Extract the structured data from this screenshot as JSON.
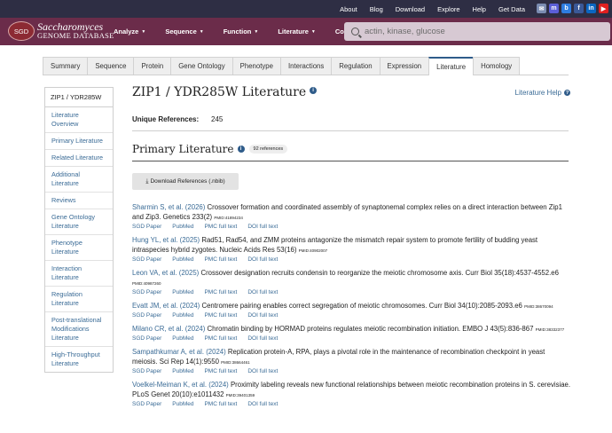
{
  "topbar": {
    "links": [
      "About",
      "Blog",
      "Download",
      "Explore",
      "Help",
      "Get Data"
    ],
    "social_icons": [
      {
        "name": "email-icon",
        "glyph": "✉",
        "color": "#7b8cb1"
      },
      {
        "name": "mastodon-icon",
        "glyph": "m",
        "color": "#5b5fd8"
      },
      {
        "name": "bluesky-icon",
        "glyph": "b",
        "color": "#2e7de0"
      },
      {
        "name": "facebook-icon",
        "glyph": "f",
        "color": "#3b5998"
      },
      {
        "name": "linkedin-icon",
        "glyph": "in",
        "color": "#0a66c2"
      },
      {
        "name": "youtube-icon",
        "glyph": "▶",
        "color": "#e02020"
      }
    ]
  },
  "navbar": {
    "logo_badge": "SGD",
    "logo_line1": "Saccharomyces",
    "logo_line2": "GENOME DATABASE",
    "menu": [
      "Analyze",
      "Sequence",
      "Function",
      "Literature",
      "Community"
    ],
    "search_placeholder": "actin, kinase, glucose"
  },
  "tabs": [
    "Summary",
    "Sequence",
    "Protein",
    "Gene Ontology",
    "Phenotype",
    "Interactions",
    "Regulation",
    "Expression",
    "Literature",
    "Homology"
  ],
  "active_tab": "Literature",
  "sidebar": {
    "header": "ZIP1 / YDR285W",
    "items": [
      "Literature Overview",
      "Primary Literature",
      "Related Literature",
      "Additional Literature",
      "Reviews",
      "Gene Ontology Literature",
      "Phenotype Literature",
      "Interaction Literature",
      "Regulation Literature",
      "Post-translational Modifications Literature",
      "High-Throughput Literature"
    ]
  },
  "page": {
    "title": "ZIP1 / YDR285W Literature",
    "help_link": "Literature Help",
    "unique_refs_label": "Unique References:",
    "unique_refs_value": "245",
    "section_title": "Primary Literature",
    "section_badge": "92 references",
    "download_button": "Download References (.nbib)"
  },
  "references": [
    {
      "authors": "Sharmin S, et al. (2026)",
      "text": " Crossover formation and coordinated assembly of synaptonemal complex relies on a direct interaction between Zip1 and Zip3. Genetics 233(2) ",
      "pmid": "PMID:41894234"
    },
    {
      "authors": "Hung YL, et al. (2025)",
      "text": " Rad51, Rad54, and ZMM proteins antagonize the mismatch repair system to promote fertility of budding yeast intraspecies hybrid zygotes. Nucleic Acids Res 53(16) ",
      "pmid": "PMID:40902007"
    },
    {
      "authors": "Leon VA, et al. (2025)",
      "text": " Crossover designation recruits condensin to reorganize the meiotic chromosome axis. Curr Biol 35(18):4537-4552.e6 ",
      "pmid": "PMID:40987260"
    },
    {
      "authors": "Evatt JM, et al. (2024)",
      "text": " Centromere pairing enables correct segregation of meiotic chromosomes. Curr Biol 34(10):2085-2093.e6 ",
      "pmid": "PMID:38670094"
    },
    {
      "authors": "Milano CR, et al. (2024)",
      "text": " Chromatin binding by HORMAD proteins regulates meiotic recombination initiation. EMBO J 43(5):836-867 ",
      "pmid": "PMID:38332377"
    },
    {
      "authors": "Sampathkumar A, et al. (2024)",
      "text": " Replication protein-A, RPA, plays a pivotal role in the maintenance of recombination checkpoint in yeast meiosis. Sci Rep 14(1):9550 ",
      "pmid": "PMID:38664461"
    },
    {
      "authors": "Voelkel-Meiman K, et al. (2024)",
      "text": " Proximity labeling reveals new functional relationships between meiotic recombination proteins in S. cerevisiae. PLoS Genet 20(10):e1011432 ",
      "pmid": "PMID:39401359"
    }
  ],
  "ref_links": [
    "SGD Paper",
    "PubMed",
    "PMC full text",
    "DOI full text"
  ]
}
